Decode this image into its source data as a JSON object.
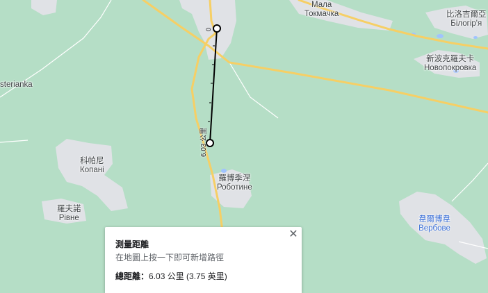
{
  "places": [
    {
      "id": "mala-tokmachka",
      "lines": [
        "Мала",
        "Токмачка"
      ],
      "blue": false
    },
    {
      "id": "bilohirya",
      "lines": [
        "比洛吉爾亞",
        "Білогір'я"
      ],
      "blue": false
    },
    {
      "id": "novopokrovka",
      "lines": [
        "新波克羅夫卡",
        "Новопокровка"
      ],
      "blue": false
    },
    {
      "id": "sterianka",
      "lines": [
        "sterianka"
      ],
      "blue": false
    },
    {
      "id": "kopani",
      "lines": [
        "科帕尼",
        "Копані"
      ],
      "blue": false
    },
    {
      "id": "robotyne",
      "lines": [
        "羅博季涅",
        "Роботине"
      ],
      "blue": false
    },
    {
      "id": "rivne",
      "lines": [
        "羅夫諾",
        "Рівне"
      ],
      "blue": false
    },
    {
      "id": "verbove",
      "lines": [
        "韋爾博韋",
        "Вербове"
      ],
      "blue": true
    }
  ],
  "measure": {
    "path_label": "6.03 公里",
    "start_label": "0"
  },
  "card": {
    "title": "測量距離",
    "hint": "在地圖上按一下即可新增路徑",
    "total_prefix": "總距離：",
    "total_value": "6.03 公里 (3.75 英里)",
    "close_glyph": "✕"
  },
  "colors": {
    "land": "#b5dec6",
    "settlement": "#e0e2e6",
    "road_major": "#f6cf65",
    "road_minor": "#ffffff",
    "measure_line": "#000000",
    "water": "#a0c3ff"
  }
}
